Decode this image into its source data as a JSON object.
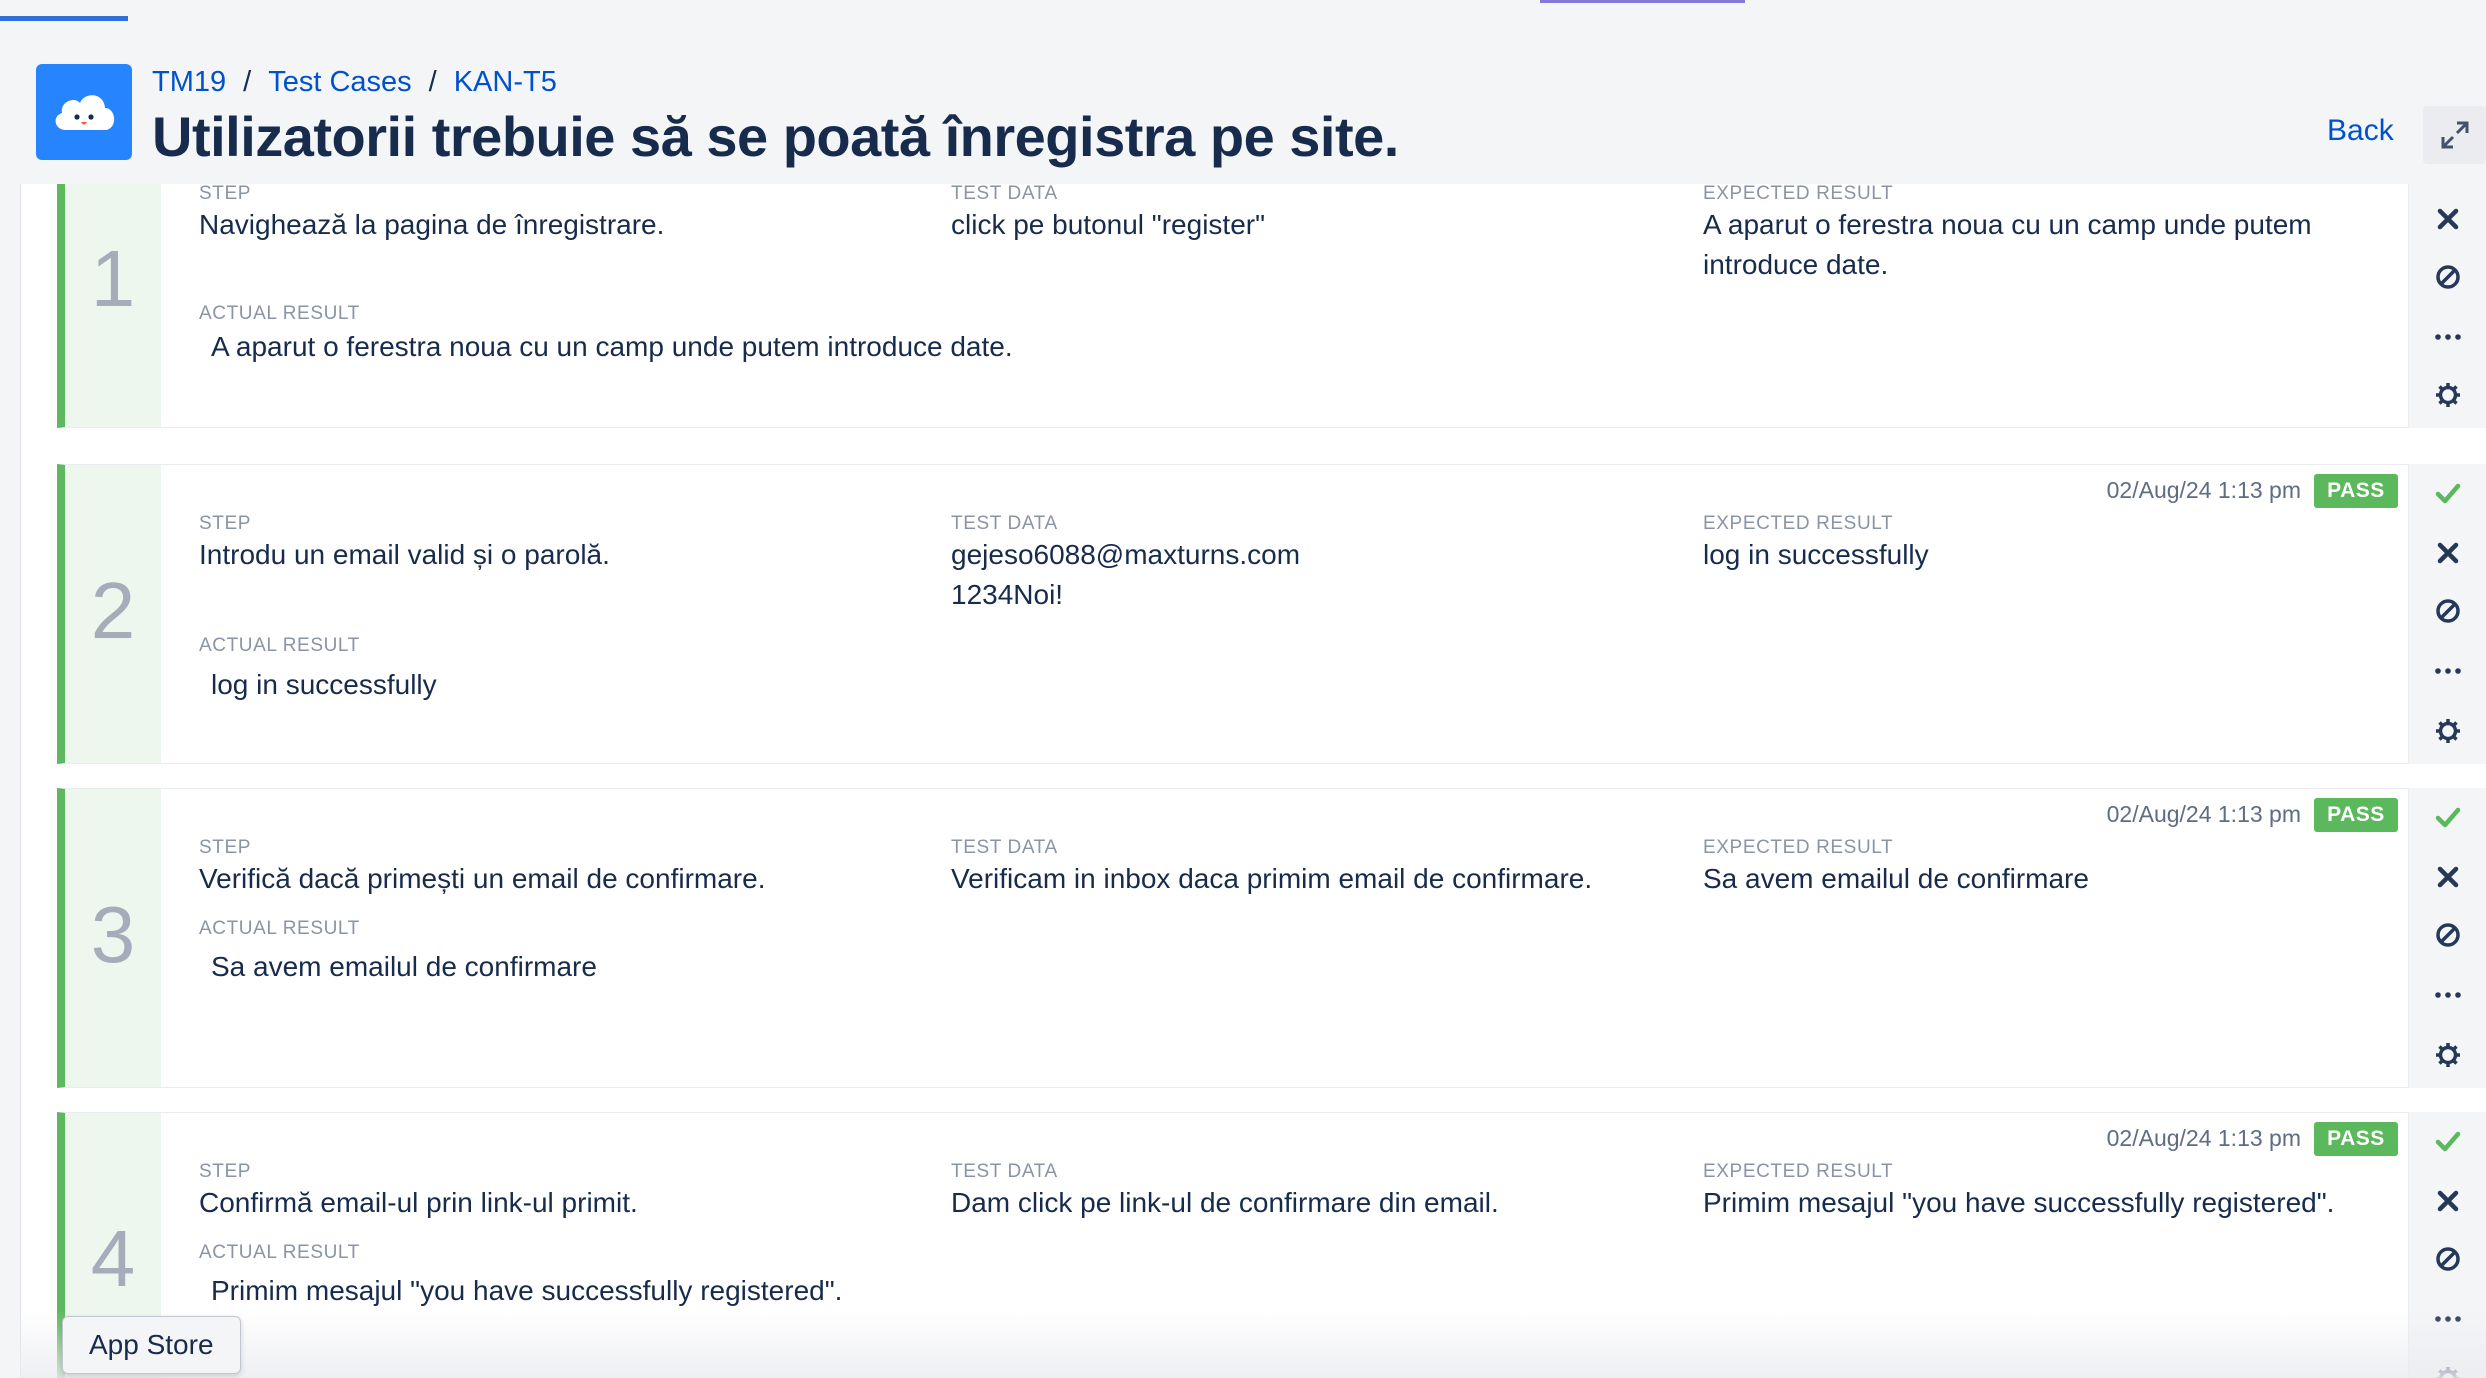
{
  "breadcrumb": {
    "project": "TM19",
    "section": "Test Cases",
    "item": "KAN-T5",
    "separator": "/"
  },
  "page": {
    "title": "Utilizatorii trebuie să se poată înregistra pe site."
  },
  "header": {
    "back_label": "Back"
  },
  "labels": {
    "step": "STEP",
    "test_data": "TEST DATA",
    "expected": "EXPECTED RESULT",
    "actual": "ACTUAL RESULT"
  },
  "steps": [
    {
      "number": "1",
      "step": "Navighează la pagina de înregistrare.",
      "test_data": "click pe butonul \"register\"",
      "expected": "A aparut o ferestra noua cu un camp unde putem introduce date.",
      "actual": "A aparut o ferestra noua cu un camp unde putem introduce date.",
      "timestamp": "",
      "status": ""
    },
    {
      "number": "2",
      "step": "Introdu un email valid și o parolă.",
      "test_data": "gejeso6088@maxturns.com\n1234Noi!",
      "expected": "log in successfully",
      "actual": "log in successfully",
      "timestamp": "02/Aug/24 1:13 pm",
      "status": "PASS"
    },
    {
      "number": "3",
      "step": "Verifică dacă primești un email de confirmare.",
      "test_data": "Verificam in inbox daca primim email de confirmare.",
      "expected": "Sa avem emailul de confirmare",
      "actual": "Sa avem emailul de confirmare",
      "timestamp": "02/Aug/24 1:13 pm",
      "status": "PASS"
    },
    {
      "number": "4",
      "step": "Confirmă email-ul prin link-ul primit.",
      "test_data": "Dam click pe link-ul de confirmare din email.",
      "expected": "Primim mesajul \"you have successfully registered\".",
      "actual": "Primim mesajul \"you have successfully registered\".",
      "timestamp": "02/Aug/24 1:13 pm",
      "status": "PASS"
    }
  ],
  "tooltip": {
    "label": "App Store"
  },
  "colors": {
    "accent": "#0052cc",
    "pass": "#5cb85c",
    "border_green": "#5fb75f",
    "logo_bg": "#2684ff"
  },
  "icons": {
    "pass": "checkmark-icon",
    "fail": "close-icon",
    "block": "blocked-icon",
    "more": "more-icon",
    "settings": "gear-icon",
    "expand": "expand-icon",
    "logo": "cloud-logo-icon"
  }
}
